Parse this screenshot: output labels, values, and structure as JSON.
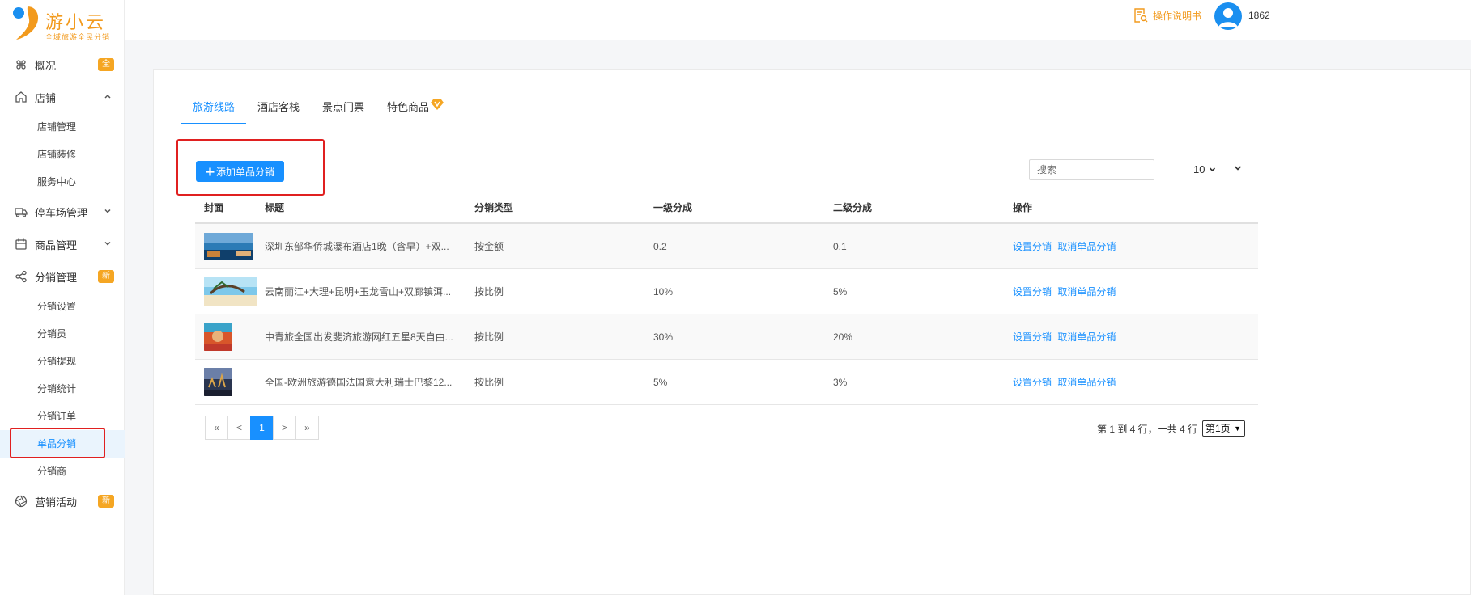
{
  "brand": {
    "title": "游小云",
    "subtitle": "全域旅游全民分销"
  },
  "sidebar": {
    "items": [
      {
        "label": "概况",
        "icon": "command-icon",
        "badge": "全"
      },
      {
        "label": "店铺",
        "icon": "home-icon",
        "expanded": true,
        "children": [
          "店铺管理",
          "店铺装修",
          "服务中心"
        ]
      },
      {
        "label": "停车场管理",
        "icon": "truck-icon",
        "expanded": false
      },
      {
        "label": "商品管理",
        "icon": "calendar-icon",
        "expanded": false
      },
      {
        "label": "分销管理",
        "icon": "share-icon",
        "badge": "新",
        "expanded": true,
        "children": [
          "分销设置",
          "分销员",
          "分销提现",
          "分销统计",
          "分销订单",
          "单品分销",
          "分销商"
        ]
      },
      {
        "label": "营销活动",
        "icon": "aperture-icon",
        "badge": "新"
      }
    ],
    "active_child": "单品分销"
  },
  "header": {
    "manual_label": "操作说明书",
    "user": "1862"
  },
  "tabs": [
    {
      "label": "旅游线路",
      "active": true
    },
    {
      "label": "酒店客栈",
      "active": false
    },
    {
      "label": "景点门票",
      "active": false
    },
    {
      "label": "特色商品",
      "active": false,
      "vip": true
    }
  ],
  "toolbar": {
    "add_label": "添加单品分销",
    "search_placeholder": "搜索",
    "page_size": "10"
  },
  "table": {
    "columns": [
      "封面",
      "标题",
      "分销类型",
      "一级分成",
      "二级分成",
      "操作"
    ],
    "rows": [
      {
        "title": "深圳东部华侨城瀑布酒店1晚（含早）+双...",
        "type": "按金额",
        "l1": "0.2",
        "l2": "0.1",
        "ops": [
          "设置分销",
          "取消单品分销"
        ]
      },
      {
        "title": "云南丽江+大理+昆明+玉龙雪山+双廊镇洱...",
        "type": "按比例",
        "l1": "10%",
        "l2": "5%",
        "ops": [
          "设置分销",
          "取消单品分销"
        ]
      },
      {
        "title": "中青旅全国出发斐济旅游网红五星8天自由...",
        "type": "按比例",
        "l1": "30%",
        "l2": "20%",
        "ops": [
          "设置分销",
          "取消单品分销"
        ]
      },
      {
        "title": "全国-欧洲旅游德国法国意大利瑞士巴黎12...",
        "type": "按比例",
        "l1": "5%",
        "l2": "3%",
        "ops": [
          "设置分销",
          "取消单品分销"
        ]
      }
    ]
  },
  "pagination": {
    "first": "«",
    "prev": "<",
    "current": "1",
    "next": ">",
    "last": "»",
    "info": "第 1 到 4 行，一共 4 行",
    "page_select": "第1页"
  },
  "colors": {
    "primary": "#1890ff",
    "brand_orange": "#f29a1d",
    "badge": "#f5a623",
    "highlight_red": "#e02020"
  }
}
